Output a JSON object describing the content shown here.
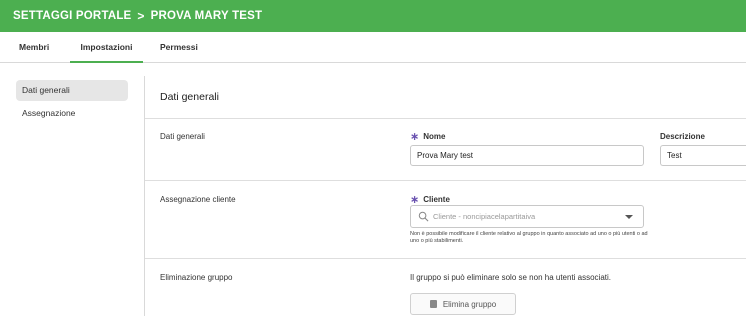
{
  "header": {
    "section": "SETTAGGI PORTALE",
    "separator": ">",
    "group_name": "PROVA MARY TEST",
    "color": "#4caf50"
  },
  "tabs": [
    {
      "label": "Membri"
    },
    {
      "label": "Impostazioni"
    },
    {
      "label": "Permessi"
    }
  ],
  "sidebar": {
    "items": [
      {
        "label": "Dati generali"
      },
      {
        "label": "Assegnazione"
      }
    ]
  },
  "main": {
    "title": "Dati generali",
    "general": {
      "row_label": "Dati generali",
      "name_label": "Nome",
      "name_value": "Prova Mary test",
      "description_label": "Descrizione",
      "description_value": "Test"
    },
    "client": {
      "row_label": "Assegnazione cliente",
      "client_label": "Cliente",
      "client_placeholder": "Cliente - noncipiacelapartitaiva",
      "help_text": "Non è possibile modificare il cliente relativo al gruppo in quanto associato ad uno o più utenti o ad uno o più stabilimenti."
    },
    "delete": {
      "row_label": "Eliminazione gruppo",
      "info_text": "Il gruppo si può eliminare solo se non ha utenti associati.",
      "button_label": "Elimina gruppo"
    },
    "required_mark": "∗"
  }
}
